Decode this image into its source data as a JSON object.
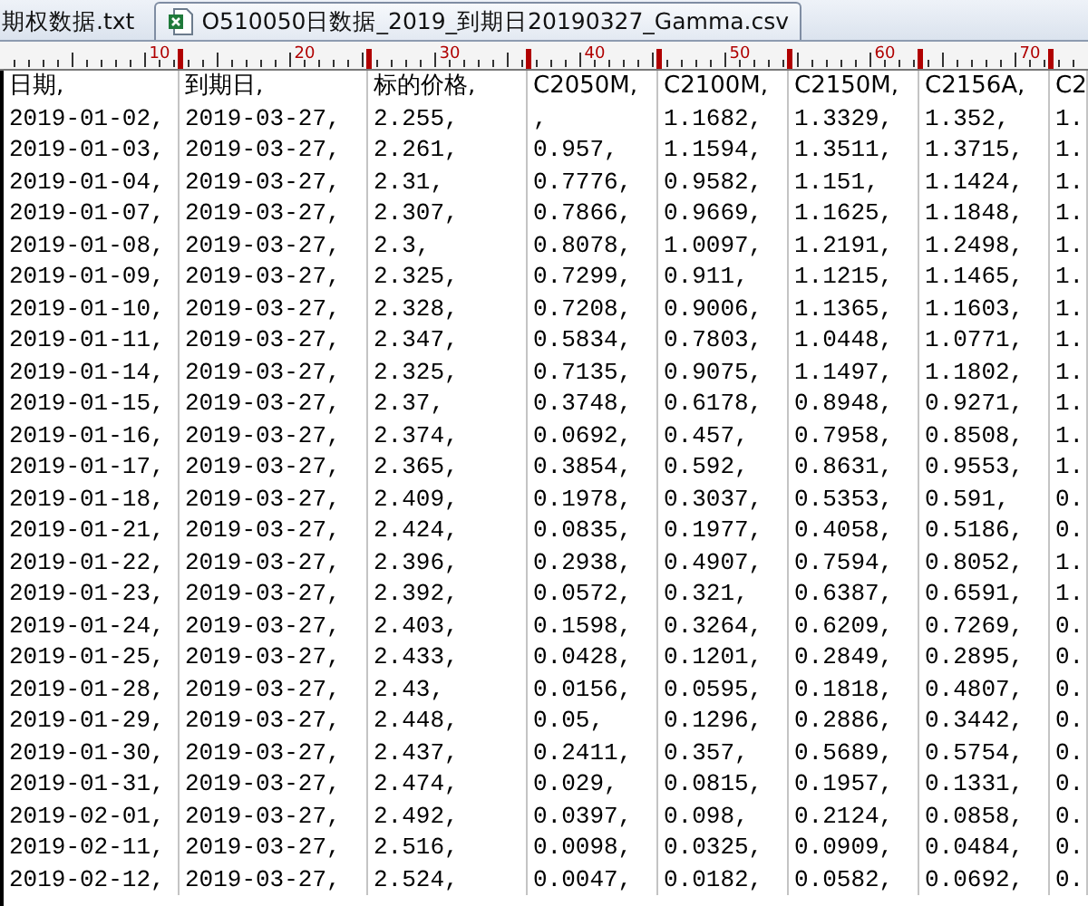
{
  "tabs": [
    {
      "label": "期权数据.txt",
      "selected": false,
      "kind": "txt"
    },
    {
      "label": "O510050日数据_2019_到期日20190327_Gamma.csv",
      "selected": true,
      "kind": "csv"
    }
  ],
  "ruler": {
    "labels": [
      "10",
      "20",
      "30",
      "40",
      "50",
      "60",
      "70"
    ]
  },
  "table": {
    "columns": [
      "日期,",
      "到期日,",
      "标的价格,",
      "C2050M,",
      "C2100M,",
      "C2150M,",
      "C2156A,",
      "C2"
    ],
    "rows": [
      [
        "2019-01-02,",
        "2019-03-27,",
        "2.255,",
        ",",
        "1.1682,",
        "1.3329,",
        "1.352,",
        "1."
      ],
      [
        "2019-01-03,",
        "2019-03-27,",
        "2.261,",
        "0.957,",
        "1.1594,",
        "1.3511,",
        "1.3715,",
        "1."
      ],
      [
        "2019-01-04,",
        "2019-03-27,",
        "2.31,",
        "0.7776,",
        "0.9582,",
        "1.151,",
        "1.1424,",
        "1."
      ],
      [
        "2019-01-07,",
        "2019-03-27,",
        "2.307,",
        "0.7866,",
        "0.9669,",
        "1.1625,",
        "1.1848,",
        "1."
      ],
      [
        "2019-01-08,",
        "2019-03-27,",
        "2.3,",
        "0.8078,",
        "1.0097,",
        "1.2191,",
        "1.2498,",
        "1."
      ],
      [
        "2019-01-09,",
        "2019-03-27,",
        "2.325,",
        "0.7299,",
        "0.911,",
        "1.1215,",
        "1.1465,",
        "1."
      ],
      [
        "2019-01-10,",
        "2019-03-27,",
        "2.328,",
        "0.7208,",
        "0.9006,",
        "1.1365,",
        "1.1603,",
        "1."
      ],
      [
        "2019-01-11,",
        "2019-03-27,",
        "2.347,",
        "0.5834,",
        "0.7803,",
        "1.0448,",
        "1.0771,",
        "1."
      ],
      [
        "2019-01-14,",
        "2019-03-27,",
        "2.325,",
        "0.7135,",
        "0.9075,",
        "1.1497,",
        "1.1802,",
        "1."
      ],
      [
        "2019-01-15,",
        "2019-03-27,",
        "2.37,",
        "0.3748,",
        "0.6178,",
        "0.8948,",
        "0.9271,",
        "1."
      ],
      [
        "2019-01-16,",
        "2019-03-27,",
        "2.374,",
        "0.0692,",
        "0.457,",
        "0.7958,",
        "0.8508,",
        "1."
      ],
      [
        "2019-01-17,",
        "2019-03-27,",
        "2.365,",
        "0.3854,",
        "0.592,",
        "0.8631,",
        "0.9553,",
        "1."
      ],
      [
        "2019-01-18,",
        "2019-03-27,",
        "2.409,",
        "0.1978,",
        "0.3037,",
        "0.5353,",
        "0.591,",
        "0."
      ],
      [
        "2019-01-21,",
        "2019-03-27,",
        "2.424,",
        "0.0835,",
        "0.1977,",
        "0.4058,",
        "0.5186,",
        "0."
      ],
      [
        "2019-01-22,",
        "2019-03-27,",
        "2.396,",
        "0.2938,",
        "0.4907,",
        "0.7594,",
        "0.8052,",
        "1."
      ],
      [
        "2019-01-23,",
        "2019-03-27,",
        "2.392,",
        "0.0572,",
        "0.321,",
        "0.6387,",
        "0.6591,",
        "1."
      ],
      [
        "2019-01-24,",
        "2019-03-27,",
        "2.403,",
        "0.1598,",
        "0.3264,",
        "0.6209,",
        "0.7269,",
        "0."
      ],
      [
        "2019-01-25,",
        "2019-03-27,",
        "2.433,",
        "0.0428,",
        "0.1201,",
        "0.2849,",
        "0.2895,",
        "0."
      ],
      [
        "2019-01-28,",
        "2019-03-27,",
        "2.43,",
        "0.0156,",
        "0.0595,",
        "0.1818,",
        "0.4807,",
        "0."
      ],
      [
        "2019-01-29,",
        "2019-03-27,",
        "2.448,",
        "0.05,",
        "0.1296,",
        "0.2886,",
        "0.3442,",
        "0."
      ],
      [
        "2019-01-30,",
        "2019-03-27,",
        "2.437,",
        "0.2411,",
        "0.357,",
        "0.5689,",
        "0.5754,",
        "0."
      ],
      [
        "2019-01-31,",
        "2019-03-27,",
        "2.474,",
        "0.029,",
        "0.0815,",
        "0.1957,",
        "0.1331,",
        "0."
      ],
      [
        "2019-02-01,",
        "2019-03-27,",
        "2.492,",
        "0.0397,",
        "0.098,",
        "0.2124,",
        "0.0858,",
        "0."
      ],
      [
        "2019-02-11,",
        "2019-03-27,",
        "2.516,",
        "0.0098,",
        "0.0325,",
        "0.0909,",
        "0.0484,",
        "0."
      ],
      [
        "2019-02-12,",
        "2019-03-27,",
        "2.524,",
        "0.0047,",
        "0.0182,",
        "0.0582,",
        "0.0692,",
        "0."
      ]
    ]
  }
}
